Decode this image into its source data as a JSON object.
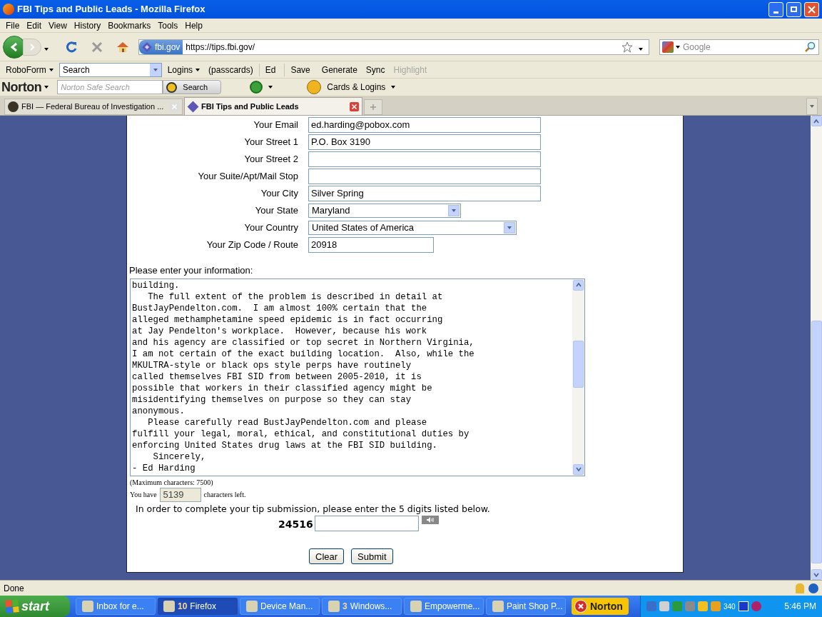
{
  "window": {
    "title": "FBI Tips and Public Leads - Mozilla Firefox"
  },
  "menu": [
    "File",
    "Edit",
    "View",
    "History",
    "Bookmarks",
    "Tools",
    "Help"
  ],
  "navbar": {
    "site_badge": "fbi.gov",
    "url": "https://tips.fbi.gov/",
    "search_placeholder": "Google"
  },
  "roboform_toolbar": [
    {
      "kind": "dropdown",
      "label": "RoboForm"
    },
    {
      "kind": "field",
      "label": "Search"
    },
    {
      "kind": "dropdown",
      "label": "Logins"
    },
    {
      "kind": "button",
      "label": "(passcards)"
    },
    {
      "kind": "separator-button",
      "label": "Ed"
    },
    {
      "kind": "separator-button",
      "label": "Save"
    },
    {
      "kind": "button",
      "label": "Generate"
    },
    {
      "kind": "button",
      "label": "Sync"
    },
    {
      "kind": "disabled",
      "label": "Highlight"
    }
  ],
  "norton_toolbar": {
    "brand": "Norton",
    "search_placeholder": "Norton Safe Search",
    "search_button": "Search",
    "cards_button": "Cards & Logins"
  },
  "tabs": [
    {
      "label": "FBI — Federal Bureau of Investigation ...",
      "selected": false
    },
    {
      "label": "FBI Tips and Public Leads",
      "selected": true
    }
  ],
  "form": {
    "fields": [
      {
        "kind": "text",
        "label": "Your Email",
        "value": "ed.harding@pobox.com"
      },
      {
        "kind": "text",
        "label": "Your Street 1",
        "value": "P.O. Box 3190"
      },
      {
        "kind": "text",
        "label": "Your Street 2"
      },
      {
        "kind": "text",
        "label": "Your Suite/Apt/Mail Stop"
      },
      {
        "kind": "text",
        "label": "Your City",
        "value": "Silver Spring"
      },
      {
        "kind": "select",
        "label": "Your State",
        "value": "Maryland"
      },
      {
        "kind": "select-wide",
        "label": "Your Country",
        "value": "United States of America"
      },
      {
        "kind": "short",
        "label": "Your Zip Code / Route",
        "value": "20918"
      }
    ],
    "info_label": "Please enter your information:",
    "info_lines": [
      "building.",
      "   The full extent of the problem is described in detail at",
      "BustJayPendelton.com.  I am almost 100% certain that the",
      "alleged methamphetamine speed epidemic is in fact occurring",
      "at Jay Pendelton's workplace.  However, because his work",
      "and his agency are classified or top secret in Northern Virginia,",
      "I am not certain of the exact building location.  Also, while the",
      "MKULTRA-style or black ops style perps have routinely",
      "called themselves FBI SID from between 2005-2010, it is",
      "possible that workers in their classified agency might be",
      "misidentifying themselves on purpose so they can stay",
      "anonymous.",
      "   Please carefully read BustJayPendelton.com and please",
      "fulfill your legal, moral, ethical, and constitutional duties by",
      "enforcing United States drug laws at the FBI SID building.",
      "    Sincerely,",
      "- Ed Harding"
    ],
    "max_note": "(Maximum characters: 7500)",
    "chars_prefix": "You have",
    "chars_left": "5139",
    "chars_suffix": "characters left.",
    "captcha_instruction": "In order to complete your tip submission, please enter the 5 digits listed below.",
    "captcha_code": "24516",
    "buttons": [
      "Clear",
      "Submit"
    ]
  },
  "status_bar": "Done",
  "taskbar": {
    "start": "start",
    "items": [
      {
        "label": "Inbox for e...",
        "selected": false
      },
      {
        "label": "Firefox",
        "count": "10",
        "selected": true
      },
      {
        "label": "Device Man...",
        "selected": false
      },
      {
        "label": "Windows...",
        "count": "3",
        "selected": false
      },
      {
        "label": "Empowerme...",
        "selected": false
      },
      {
        "label": "Paint Shop P...",
        "selected": false
      }
    ],
    "norton": "Norton",
    "tray_reading": "340",
    "clock": "5:46 PM"
  }
}
